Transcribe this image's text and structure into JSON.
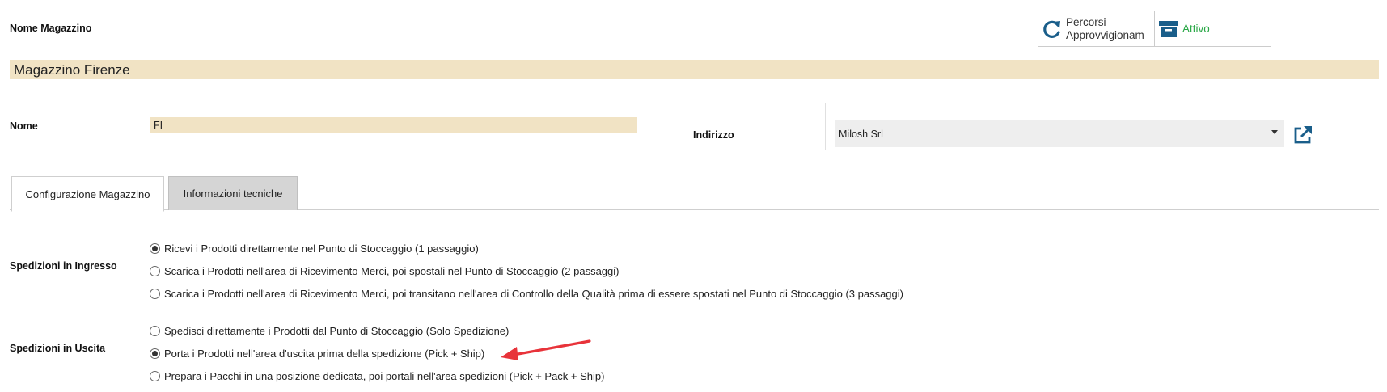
{
  "header": {
    "nome_magazzino_label": "Nome Magazzino",
    "warehouse_title": "Magazzino Firenze"
  },
  "smart_buttons": {
    "routes_line1": "Percorsi",
    "routes_line2": "Approvvigionam",
    "status_label": "Attivo"
  },
  "form": {
    "nome_label": "Nome",
    "nome_value": "FI",
    "indirizzo_label": "Indirizzo",
    "indirizzo_value": "Milosh Srl"
  },
  "tabs": [
    {
      "label": "Configurazione Magazzino",
      "active": true
    },
    {
      "label": "Informazioni tecniche",
      "active": false
    }
  ],
  "incoming": {
    "label": "Spedizioni in Ingresso",
    "options": [
      {
        "label": "Ricevi i Prodotti direttamente nel Punto di Stoccaggio (1 passaggio)",
        "checked": true
      },
      {
        "label": "Scarica i Prodotti nell'area di Ricevimento Merci, poi spostali nel Punto di Stoccaggio (2 passaggi)",
        "checked": false
      },
      {
        "label": "Scarica i Prodotti nell'area di Ricevimento Merci, poi transitano nell'area di Controllo della Qualità prima di essere spostati nel Punto di Stoccaggio (3 passaggi)",
        "checked": false
      }
    ]
  },
  "outgoing": {
    "label": "Spedizioni in Uscita",
    "options": [
      {
        "label": "Spedisci direttamente i Prodotti dal Punto di Stoccaggio (Solo Spedizione)",
        "checked": false
      },
      {
        "label": "Porta i Prodotti nell'area d'uscita prima della spedizione (Pick + Ship)",
        "checked": true
      },
      {
        "label": "Prepara i Pacchi in una posizione dedicata, poi portali nell'area spedizioni (Pick + Pack + Ship)",
        "checked": false
      }
    ]
  },
  "colors": {
    "accent_blue": "#1a5e8a",
    "field_highlight": "#f1e3c4",
    "status_green": "#28a745",
    "arrow_red": "#e8333a"
  }
}
